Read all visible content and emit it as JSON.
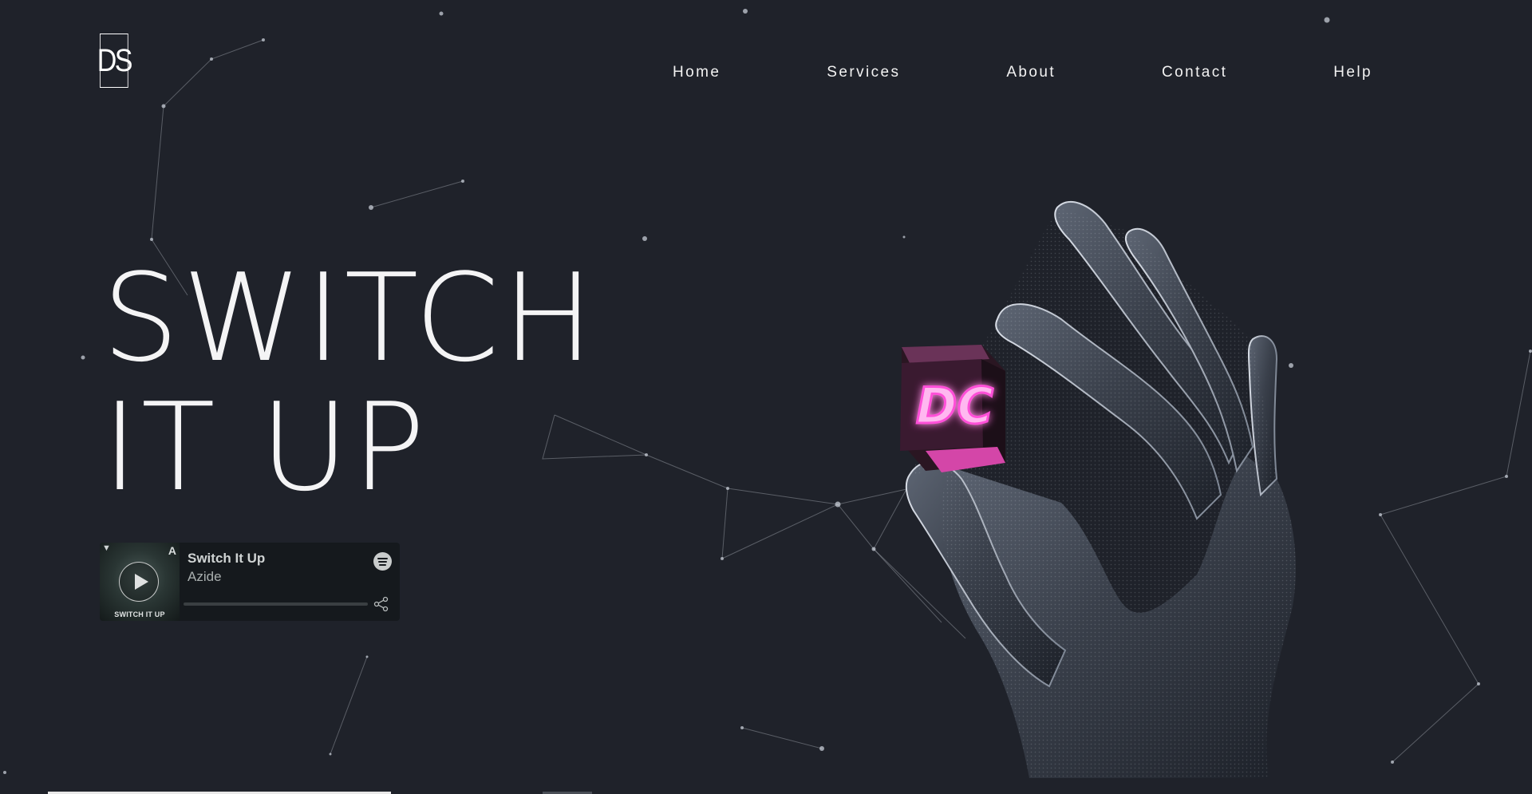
{
  "brand": {
    "logo_text": "DS"
  },
  "nav": {
    "items": [
      {
        "label": "Home"
      },
      {
        "label": "Services"
      },
      {
        "label": "About"
      },
      {
        "label": "Contact"
      },
      {
        "label": "Help"
      }
    ]
  },
  "hero": {
    "line1": "SWITCH",
    "line2": "IT UP",
    "cube_text": "DC"
  },
  "player": {
    "track": "Switch It Up",
    "artist": "Azide",
    "cover_caption": "SWITCH IT UP",
    "progress": 0.0,
    "icons": [
      "play-icon",
      "spotify-icon",
      "share-icon"
    ]
  },
  "slider": {
    "active_index": 0,
    "count": 2
  },
  "colors": {
    "background": "#1f222a",
    "text": "#ffffff",
    "neon_pink": "#ff4fd8",
    "player_bg": "#15191d"
  }
}
